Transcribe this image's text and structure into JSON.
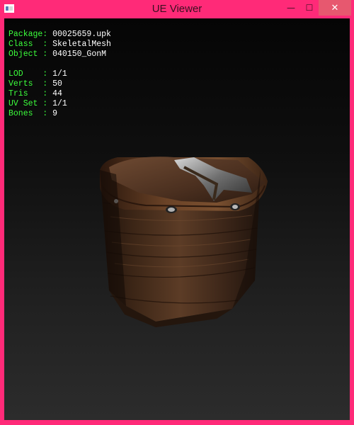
{
  "window": {
    "title": "UE Viewer",
    "controls": {
      "minimize": "—",
      "maximize": "☐",
      "close": "✕"
    }
  },
  "info": {
    "rows1": [
      {
        "label": "Package: ",
        "value": "00025659.upk"
      },
      {
        "label": "Class  : ",
        "value": "SkeletalMesh"
      },
      {
        "label": "Object : ",
        "value": "040150_GonM"
      }
    ],
    "rows2": [
      {
        "label": "LOD    : ",
        "value": "1/1"
      },
      {
        "label": "Verts  : ",
        "value": "50"
      },
      {
        "label": "Tris   : ",
        "value": "44"
      },
      {
        "label": "UV Set : ",
        "value": "1/1"
      },
      {
        "label": "Bones  : ",
        "value": "9"
      }
    ]
  },
  "colors": {
    "titlebar": "#ff2a78",
    "close_button": "#e7586f",
    "label_text": "#3cff3c",
    "value_text": "#ffffff",
    "wood_dark": "#2b190f",
    "wood_mid": "#5a3b25"
  }
}
